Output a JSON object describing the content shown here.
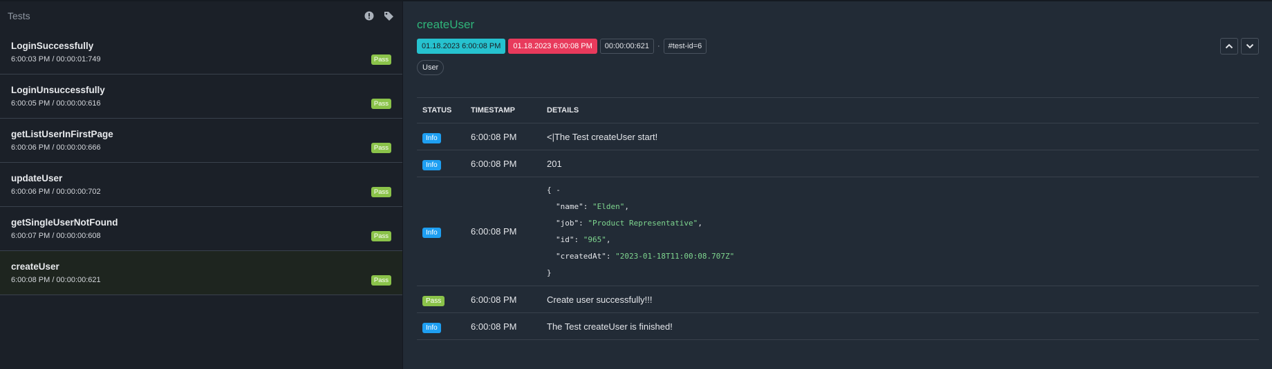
{
  "sidebar": {
    "title": "Tests",
    "icons": {
      "filter": "exclamation-circle-icon",
      "tags": "tag-icon"
    },
    "tests": [
      {
        "name": "LoginSuccessfully",
        "time": "6:00:03 PM / 00:00:01:749",
        "status": "Pass"
      },
      {
        "name": "LoginUnsuccessfully",
        "time": "6:00:05 PM / 00:00:00:616",
        "status": "Pass"
      },
      {
        "name": "getListUserInFirstPage",
        "time": "6:00:06 PM / 00:00:00:666",
        "status": "Pass"
      },
      {
        "name": "updateUser",
        "time": "6:00:06 PM / 00:00:00:702",
        "status": "Pass"
      },
      {
        "name": "getSingleUserNotFound",
        "time": "6:00:07 PM / 00:00:00:608",
        "status": "Pass"
      },
      {
        "name": "createUser",
        "time": "6:00:08 PM / 00:00:00:621",
        "status": "Pass"
      }
    ]
  },
  "detail": {
    "title": "createUser",
    "start": "01.18.2023 6:00:08 PM",
    "end": "01.18.2023 6:00:08 PM",
    "duration": "00:00:00:621",
    "separator": "·",
    "test_id": "#test-id=6",
    "tag": "User",
    "nav": {
      "up": "chevron-up-icon",
      "down": "chevron-down-icon"
    },
    "columns": {
      "status": "STATUS",
      "timestamp": "TIMESTAMP",
      "details": "DETAILS"
    },
    "logs": [
      {
        "status": "Info",
        "timestamp": "6:00:08 PM",
        "details": "<|The Test createUser start!"
      },
      {
        "status": "Info",
        "timestamp": "6:00:08 PM",
        "details": "201"
      },
      {
        "status": "Info",
        "timestamp": "6:00:08 PM",
        "json": {
          "open": "{ -",
          "name_key": "\"name\": ",
          "name_val": "\"Elden\"",
          "job_key": "\"job\": ",
          "job_val": "\"Product Representative\"",
          "id_key": "\"id\": ",
          "id_val": "\"965\"",
          "created_key": "\"createdAt\": ",
          "created_val": "\"2023-01-18T11:00:08.707Z\"",
          "comma": ",",
          "close": "}"
        }
      },
      {
        "status": "Pass",
        "timestamp": "6:00:08 PM",
        "details": "Create user successfully!!!"
      },
      {
        "status": "Info",
        "timestamp": "6:00:08 PM",
        "details": "The Test createUser is finished!"
      }
    ]
  },
  "colors": {
    "pass": "#8bc34a",
    "info": "#1e9ff2",
    "start": "#26c2cf",
    "end": "#e83a5c",
    "title": "#2fb57a"
  }
}
